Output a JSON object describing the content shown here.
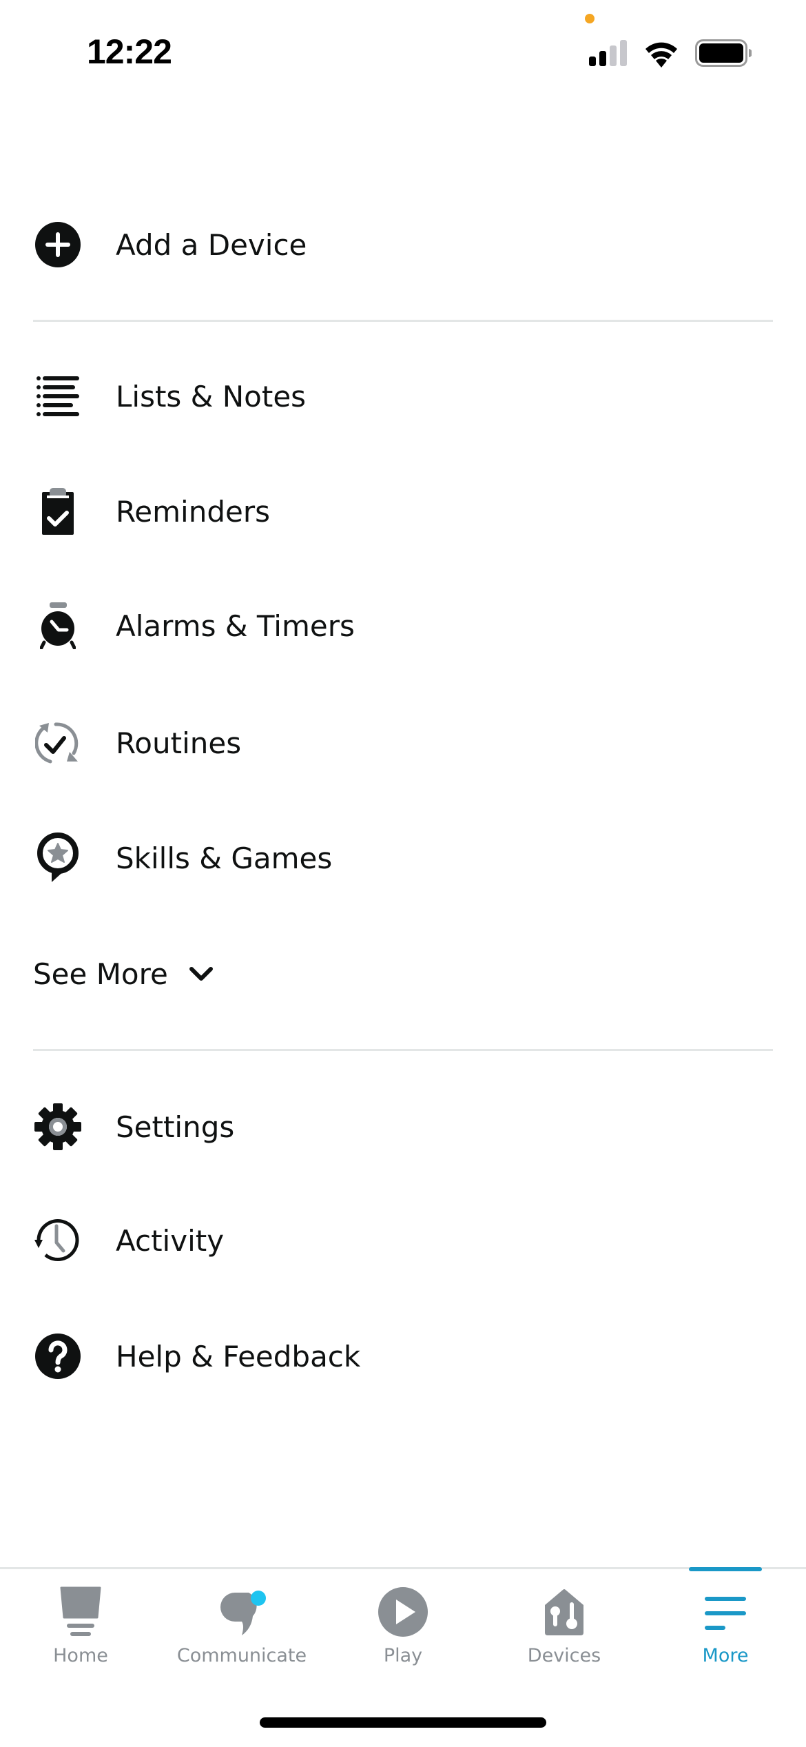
{
  "status_bar": {
    "time": "12:22",
    "signal_bars_active": 2,
    "signal_bars_total": 4,
    "battery_level": 0.95,
    "recording_indicator_color": "#f5a623"
  },
  "menu": {
    "top_items": [
      {
        "label": "Add a Device",
        "icon": "plus-circle-icon"
      }
    ],
    "primary_items": [
      {
        "label": "Lists & Notes",
        "icon": "list-icon"
      },
      {
        "label": "Reminders",
        "icon": "clipboard-check-icon"
      },
      {
        "label": "Alarms & Timers",
        "icon": "alarm-clock-icon"
      },
      {
        "label": "Routines",
        "icon": "routine-refresh-check-icon"
      },
      {
        "label": "Skills & Games",
        "icon": "speech-bubble-star-icon"
      }
    ],
    "see_more_label": "See More",
    "secondary_items": [
      {
        "label": "Settings",
        "icon": "gear-icon"
      },
      {
        "label": "Activity",
        "icon": "history-clock-icon"
      },
      {
        "label": "Help & Feedback",
        "icon": "question-circle-icon"
      }
    ]
  },
  "tabbar": {
    "accent_color": "#1a98c7",
    "inactive_color": "#8a8f94",
    "notification_dot_color": "#1ec4f0",
    "tabs": [
      {
        "label": "Home",
        "icon": "home-echo-icon",
        "active": false
      },
      {
        "label": "Communicate",
        "icon": "chat-bubble-icon",
        "active": false,
        "has_notification": true
      },
      {
        "label": "Play",
        "icon": "play-circle-icon",
        "active": false
      },
      {
        "label": "Devices",
        "icon": "devices-house-icon",
        "active": false
      },
      {
        "label": "More",
        "icon": "hamburger-menu-icon",
        "active": true
      }
    ]
  }
}
